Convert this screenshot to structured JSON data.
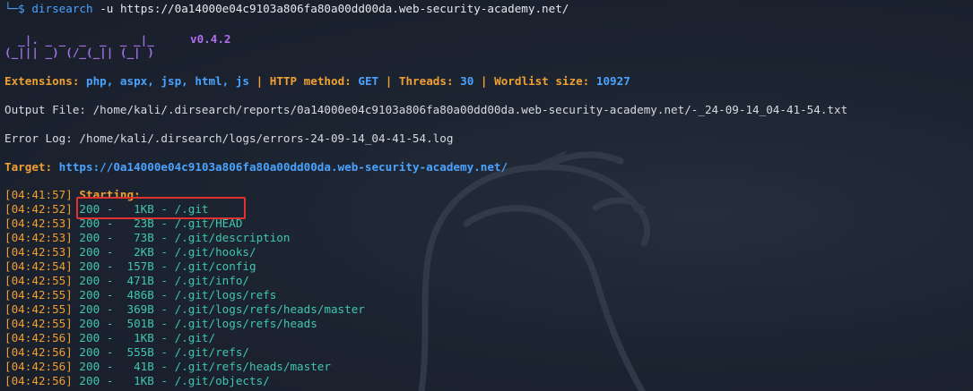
{
  "terminal": {
    "prompt": "└─$",
    "command": "dirsearch",
    "flag": "-u",
    "url": "https://0a14000e04c9103a806fa80a00dd00da.web-security-academy.net/"
  },
  "banner": {
    "logo_line1": "  _|. _ _  _  _  _ _|_",
    "logo_line2": "(_||| _) (/_(_|| (_| )",
    "version": "v0.4.2"
  },
  "config": {
    "extensions_label": "Extensions:",
    "extensions_value": "php, aspx, jsp, html, js",
    "sep": "|",
    "method_label": "HTTP method:",
    "method_value": "GET",
    "threads_label": "Threads:",
    "threads_value": "30",
    "wordlist_label": "Wordlist size:",
    "wordlist_value": "10927"
  },
  "output_file": "Output File: /home/kali/.dirsearch/reports/0a14000e04c9103a806fa80a00dd00da.web-security-academy.net/-_24-09-14_04-41-54.txt",
  "error_log": "Error Log: /home/kali/.dirsearch/logs/errors-24-09-14_04-41-54.log",
  "target": {
    "label": "Target:",
    "value": "https://0a14000e04c9103a806fa80a00dd00da.web-security-academy.net/"
  },
  "starting": {
    "time": "[04:41:57]",
    "label": "Starting:"
  },
  "results": [
    {
      "time": "[04:42:52]",
      "status": "200",
      "size": "1KB",
      "path": "/.git"
    },
    {
      "time": "[04:42:53]",
      "status": "200",
      "size": "23B",
      "path": "/.git/HEAD"
    },
    {
      "time": "[04:42:53]",
      "status": "200",
      "size": "73B",
      "path": "/.git/description"
    },
    {
      "time": "[04:42:53]",
      "status": "200",
      "size": "2KB",
      "path": "/.git/hooks/"
    },
    {
      "time": "[04:42:54]",
      "status": "200",
      "size": "157B",
      "path": "/.git/config"
    },
    {
      "time": "[04:42:55]",
      "status": "200",
      "size": "471B",
      "path": "/.git/info/"
    },
    {
      "time": "[04:42:55]",
      "status": "200",
      "size": "486B",
      "path": "/.git/logs/refs"
    },
    {
      "time": "[04:42:55]",
      "status": "200",
      "size": "369B",
      "path": "/.git/logs/refs/heads/master"
    },
    {
      "time": "[04:42:55]",
      "status": "200",
      "size": "501B",
      "path": "/.git/logs/refs/heads"
    },
    {
      "time": "[04:42:56]",
      "status": "200",
      "size": "1KB",
      "path": "/.git/"
    },
    {
      "time": "[04:42:56]",
      "status": "200",
      "size": "555B",
      "path": "/.git/refs/"
    },
    {
      "time": "[04:42:56]",
      "status": "200",
      "size": "41B",
      "path": "/.git/refs/heads/master"
    },
    {
      "time": "[04:42:56]",
      "status": "200",
      "size": "1KB",
      "path": "/.git/objects/"
    }
  ],
  "colors": {
    "background": "#1d2431",
    "accent_orange": "#f0a030",
    "accent_blue": "#4aa3ff",
    "hit_cyan": "#3fc6b0",
    "highlight_red": "#e23131"
  },
  "icons": {
    "background_watermark": "kali-dragon-icon"
  }
}
